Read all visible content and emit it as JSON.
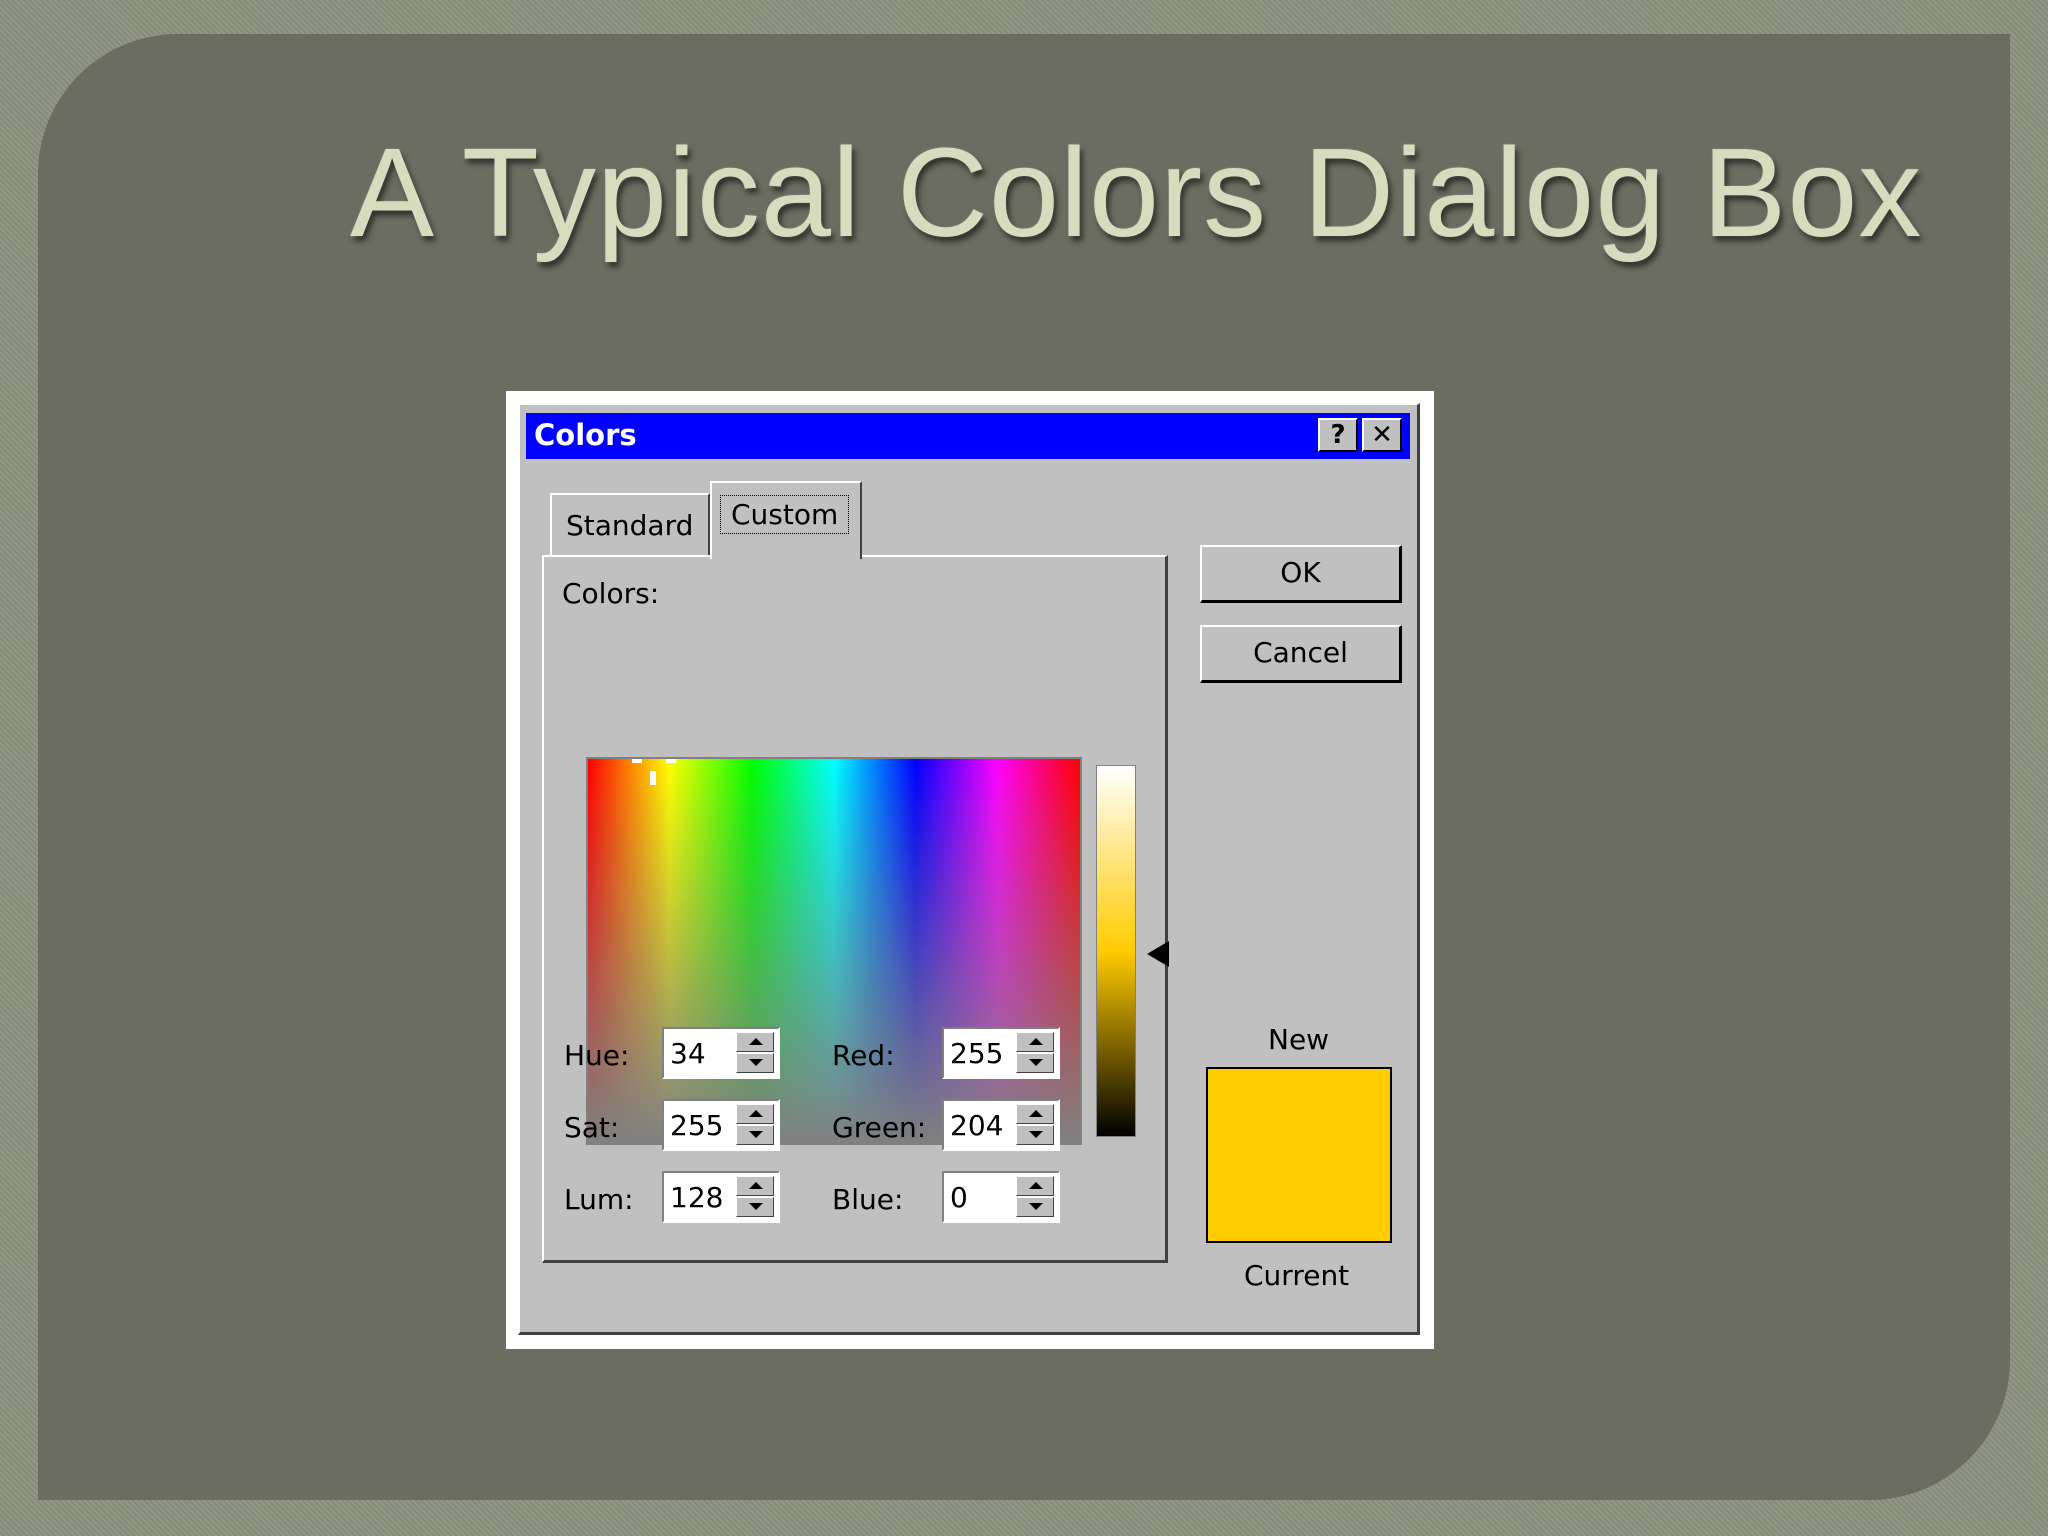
{
  "slide": {
    "title": "A Typical Colors Dialog Box"
  },
  "dialog": {
    "title": "Colors",
    "help_label": "?",
    "close_label": "✕",
    "tabs": [
      {
        "label": "Standard"
      },
      {
        "label": "Custom"
      }
    ],
    "colors_label": "Colors:",
    "fields": {
      "hue": {
        "label": "Hue:",
        "value": "34"
      },
      "sat": {
        "label": "Sat:",
        "value": "255"
      },
      "lum": {
        "label": "Lum:",
        "value": "128"
      },
      "red": {
        "label": "Red:",
        "value": "255"
      },
      "green": {
        "label": "Green:",
        "value": "204"
      },
      "blue": {
        "label": "Blue:",
        "value": "0"
      }
    },
    "ok_label": "OK",
    "cancel_label": "Cancel",
    "new_label": "New",
    "current_label": "Current",
    "preview_color": "#ffcc00",
    "titlebar_color": "#0000ff"
  }
}
